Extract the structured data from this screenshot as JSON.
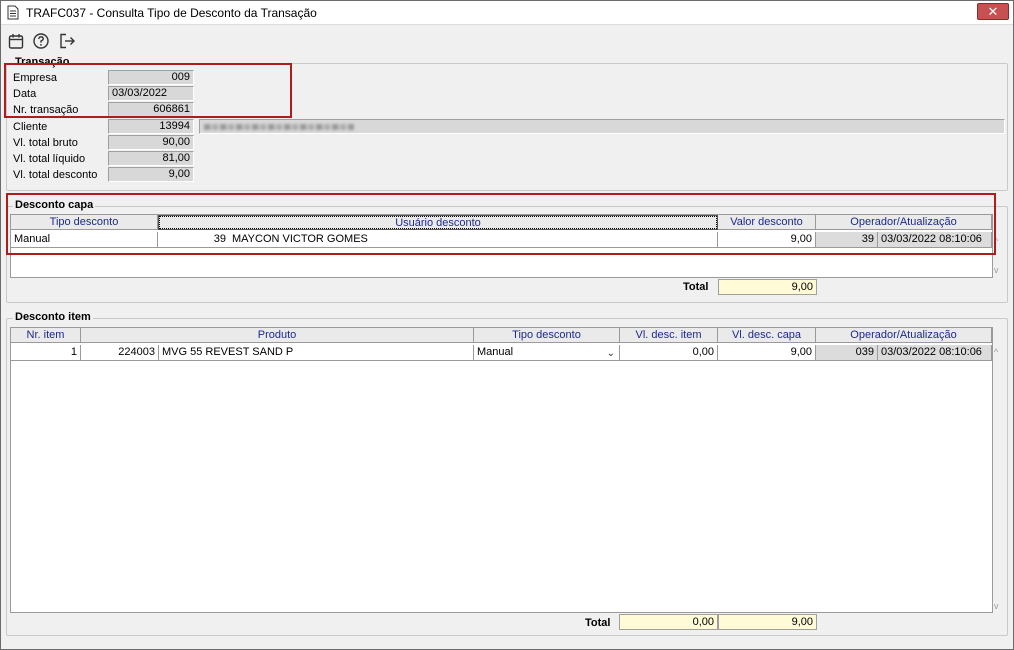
{
  "window": {
    "title": "TRAFC037 - Consulta Tipo de Desconto da Transação",
    "close_glyph": "✕"
  },
  "toolbar": {
    "icons": [
      "calendar-icon",
      "help-icon",
      "exit-icon"
    ]
  },
  "transacao": {
    "legend": "Transação",
    "fields": {
      "empresa": {
        "label": "Empresa",
        "value": "009"
      },
      "data": {
        "label": "Data",
        "value": "03/03/2022"
      },
      "nr_transacao": {
        "label": "Nr. transação",
        "value": "606861"
      },
      "cliente": {
        "label": "Cliente",
        "value": "13994"
      },
      "vl_total_bruto": {
        "label": "Vl. total bruto",
        "value": "90,00"
      },
      "vl_total_liquido": {
        "label": "Vl. total líquido",
        "value": "81,00"
      },
      "vl_total_desconto": {
        "label": "Vl. total desconto",
        "value": "9,00"
      }
    }
  },
  "desconto_capa": {
    "legend": "Desconto capa",
    "columns": [
      "Tipo desconto",
      "Usuário desconto",
      "Valor desconto",
      "Operador/Atualização"
    ],
    "row": {
      "tipo": "Manual",
      "usuario_codigo": "39",
      "usuario_nome": "MAYCON VICTOR GOMES",
      "valor": "9,00",
      "operador": "39",
      "atualizacao": "03/03/2022 08:10:06"
    },
    "total_label": "Total",
    "total_value": "9,00"
  },
  "desconto_item": {
    "legend": "Desconto item",
    "columns": [
      "Nr. item",
      "Produto",
      "Tipo desconto",
      "Vl. desc. item",
      "Vl. desc. capa",
      "Operador/Atualização"
    ],
    "row": {
      "nr_item": "1",
      "produto_codigo": "224003",
      "produto_nome": "MVG 55 REVEST SAND P",
      "tipo": "Manual",
      "vl_desc_item": "0,00",
      "vl_desc_capa": "9,00",
      "operador": "039",
      "atualizacao": "03/03/2022 08:10:06"
    },
    "total_label": "Total",
    "total_item": "0,00",
    "total_capa": "9,00"
  },
  "colors": {
    "highlight_border": "#b01c1c",
    "header_text": "#1e2a8a",
    "total_bg": "#fffbd6",
    "close_bg": "#c75050"
  }
}
